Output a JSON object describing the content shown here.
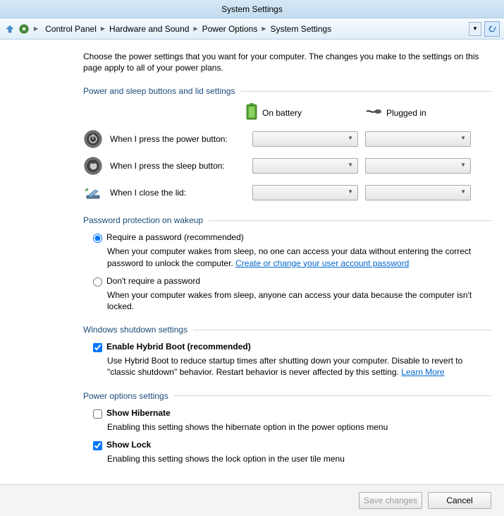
{
  "window": {
    "title": "System Settings"
  },
  "breadcrumb": {
    "items": [
      "Control Panel",
      "Hardware and Sound",
      "Power Options",
      "System Settings"
    ]
  },
  "intro": "Choose the power settings that you want for your computer. The changes you make to the settings on this page apply to all of your power plans.",
  "buttons_section": {
    "title": "Power and sleep buttons and lid settings",
    "col_battery": "On battery",
    "col_plugged": "Plugged in",
    "rows": [
      {
        "label": "When I press the power button:"
      },
      {
        "label": "When I press the sleep button:"
      },
      {
        "label": "When I close the lid:"
      }
    ]
  },
  "password_section": {
    "title": "Password protection on wakeup",
    "require": {
      "label": "Require a password (recommended)",
      "desc_pre": "When your computer wakes from sleep, no one can access your data without entering the correct password to unlock the computer. ",
      "link": "Create or change your user account password"
    },
    "norequire": {
      "label": "Don't require a password",
      "desc": "When your computer wakes from sleep, anyone can access your data because the computer isn't locked."
    }
  },
  "shutdown_section": {
    "title": "Windows shutdown settings",
    "hybrid": {
      "label": "Enable Hybrid Boot (recommended)",
      "desc_pre": "Use Hybrid Boot to reduce startup times after shutting down your computer. Disable to revert to \"classic shutdown\" behavior. Restart behavior is never affected by this setting. ",
      "link": "Learn More"
    }
  },
  "poweropts_section": {
    "title": "Power options settings",
    "hibernate": {
      "label": "Show Hibernate",
      "desc": "Enabling this setting shows the hibernate option in the power options menu"
    },
    "lock": {
      "label": "Show Lock",
      "desc": "Enabling this setting shows the lock option in the user tile menu"
    }
  },
  "footer": {
    "save": "Save changes",
    "cancel": "Cancel"
  }
}
